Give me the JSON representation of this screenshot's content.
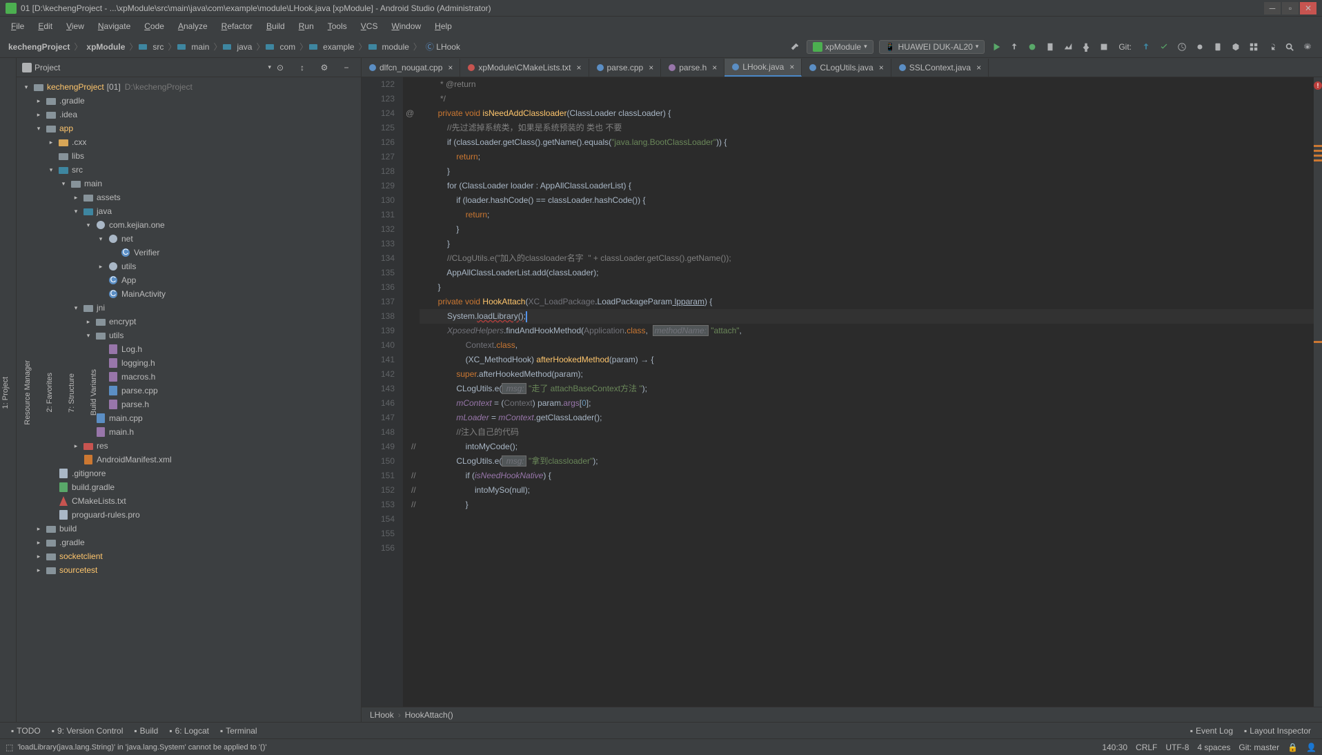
{
  "titlebar": "01 [D:\\kechengProject - ...\\xpModule\\src\\main\\java\\com\\example\\module\\LHook.java [xpModule] - Android Studio (Administrator)",
  "menu": [
    "File",
    "Edit",
    "View",
    "Navigate",
    "Code",
    "Analyze",
    "Refactor",
    "Build",
    "Run",
    "Tools",
    "VCS",
    "Window",
    "Help"
  ],
  "breadcrumb": [
    "kechengProject",
    "xpModule",
    "src",
    "main",
    "java",
    "com",
    "example",
    "module",
    "LHook"
  ],
  "runConfig": {
    "module": "xpModule",
    "device": "HUAWEI DUK-AL20"
  },
  "gitLabel": "Git:",
  "projectPanel": {
    "title": "Project"
  },
  "leftGutter": [
    "1: Project",
    "Resource Manager",
    "2: Favorites",
    "7: Structure",
    "Build Variants"
  ],
  "tree": {
    "root": {
      "name": "kechengProject",
      "tag": "[01]",
      "hint": "D:\\kechengProject"
    },
    "nodes": [
      {
        "indent": 1,
        "arrow": "▸",
        "icon": "folder",
        "label": ".gradle"
      },
      {
        "indent": 1,
        "arrow": "▸",
        "icon": "folder",
        "label": ".idea"
      },
      {
        "indent": 1,
        "arrow": "▾",
        "icon": "folder",
        "label": "app",
        "highlight": true
      },
      {
        "indent": 2,
        "arrow": "▸",
        "icon": "folder-y",
        "label": ".cxx"
      },
      {
        "indent": 2,
        "arrow": "",
        "icon": "folder",
        "label": "libs"
      },
      {
        "indent": 2,
        "arrow": "▾",
        "icon": "folder-src",
        "label": "src"
      },
      {
        "indent": 3,
        "arrow": "▾",
        "icon": "folder",
        "label": "main"
      },
      {
        "indent": 4,
        "arrow": "▸",
        "icon": "folder",
        "label": "assets"
      },
      {
        "indent": 4,
        "arrow": "▾",
        "icon": "folder-src",
        "label": "java"
      },
      {
        "indent": 5,
        "arrow": "▾",
        "icon": "pkg",
        "label": "com.kejian.one"
      },
      {
        "indent": 6,
        "arrow": "▾",
        "icon": "pkg",
        "label": "net"
      },
      {
        "indent": 7,
        "arrow": "",
        "icon": "class",
        "label": "Verifier"
      },
      {
        "indent": 6,
        "arrow": "▸",
        "icon": "pkg",
        "label": "utils"
      },
      {
        "indent": 6,
        "arrow": "",
        "icon": "class",
        "label": "App"
      },
      {
        "indent": 6,
        "arrow": "",
        "icon": "class",
        "label": "MainActivity"
      },
      {
        "indent": 4,
        "arrow": "▾",
        "icon": "folder",
        "label": "jni"
      },
      {
        "indent": 5,
        "arrow": "▸",
        "icon": "folder",
        "label": "encrypt"
      },
      {
        "indent": 5,
        "arrow": "▾",
        "icon": "folder",
        "label": "utils"
      },
      {
        "indent": 6,
        "arrow": "",
        "icon": "file-h",
        "label": "Log.h"
      },
      {
        "indent": 6,
        "arrow": "",
        "icon": "file-h",
        "label": "logging.h"
      },
      {
        "indent": 6,
        "arrow": "",
        "icon": "file-h",
        "label": "macros.h"
      },
      {
        "indent": 6,
        "arrow": "",
        "icon": "file-cpp",
        "label": "parse.cpp"
      },
      {
        "indent": 6,
        "arrow": "",
        "icon": "file-h",
        "label": "parse.h"
      },
      {
        "indent": 5,
        "arrow": "",
        "icon": "file-cpp",
        "label": "main.cpp"
      },
      {
        "indent": 5,
        "arrow": "",
        "icon": "file-h",
        "label": "main.h"
      },
      {
        "indent": 4,
        "arrow": "▸",
        "icon": "folder-res",
        "label": "res"
      },
      {
        "indent": 4,
        "arrow": "",
        "icon": "file-xml",
        "label": "AndroidManifest.xml"
      },
      {
        "indent": 2,
        "arrow": "",
        "icon": "file",
        "label": ".gitignore"
      },
      {
        "indent": 2,
        "arrow": "",
        "icon": "file-gradle",
        "label": "build.gradle"
      },
      {
        "indent": 2,
        "arrow": "",
        "icon": "file-cmake",
        "label": "CMakeLists.txt"
      },
      {
        "indent": 2,
        "arrow": "",
        "icon": "file",
        "label": "proguard-rules.pro"
      },
      {
        "indent": 1,
        "arrow": "▸",
        "icon": "folder",
        "label": "build"
      },
      {
        "indent": 1,
        "arrow": "▸",
        "icon": "folder",
        "label": ".gradle"
      },
      {
        "indent": 1,
        "arrow": "▸",
        "icon": "folder",
        "label": "socketclient",
        "highlight": true
      },
      {
        "indent": 1,
        "arrow": "▸",
        "icon": "folder",
        "label": "sourcetest",
        "highlight": true
      }
    ]
  },
  "tabs": [
    {
      "icon": "cpp",
      "label": "dlfcn_nougat.cpp"
    },
    {
      "icon": "cmake",
      "label": "xpModule\\CMakeLists.txt"
    },
    {
      "icon": "cpp",
      "label": "parse.cpp"
    },
    {
      "icon": "h",
      "label": "parse.h"
    },
    {
      "icon": "java",
      "label": "LHook.java",
      "active": true
    },
    {
      "icon": "java",
      "label": "CLogUtils.java"
    },
    {
      "icon": "java",
      "label": "SSLContext.java"
    }
  ],
  "code": {
    "lines": [
      122,
      123,
      124,
      125,
      126,
      127,
      128,
      129,
      130,
      131,
      132,
      133,
      134,
      135,
      136,
      137,
      138,
      139,
      140,
      141,
      142,
      143,
      146,
      147,
      148,
      149,
      150,
      151,
      152,
      153,
      154,
      155,
      156
    ],
    "content": {
      "l122": "         * @return",
      "l123": "         */",
      "l124_kw1": "private",
      "l124_kw2": "void",
      "l124_fn": "isNeedAddClassloader",
      "l124_rest": "(ClassLoader classLoader) {",
      "l126_cmt": "            //先过滤掉系统类，如果是系统预装的 类也 不要",
      "l127_a": "            if (classLoader.getClass().getName().equals(",
      "l127_s": "\"java.lang.BootClassLoader\"",
      "l127_b": ")) {",
      "l128_kw": "return",
      "l128_s": ";",
      "l129": "            }",
      "l130_a": "            for (",
      "l130_t": "ClassLoader",
      "l130_b": " loader : AppAllClassLoaderList) {",
      "l131": "                if (loader.hashCode() == classLoader.hashCode()) {",
      "l132_kw": "return",
      "l132_s": ";",
      "l133": "                }",
      "l134": "            }",
      "l135_cmt": "            //CLogUtils.e(\"加入的classloader名字  \" + classLoader.getClass().getName());",
      "l136": "            AppAllClassLoaderList.add(classLoader);",
      "l137": "        }",
      "l139_kw1": "private",
      "l139_kw2": "void",
      "l139_fn": "HookAttach",
      "l139_a": "(",
      "l139_t1": "XC_LoadPackage",
      "l139_t2": ".LoadPackageParam",
      "l139_p": " lpparam",
      "l139_b": ") {",
      "l140_a": "            System.",
      "l140_err": "loadLibrary()",
      "l140_b": ";",
      "l141_a": "            ",
      "l141_t": "XposedHelpers",
      "l141_b": ".findAndHookMethod(",
      "l141_c": "Application",
      "l141_d": ".",
      "l141_kw": "class",
      "l141_e": ",  ",
      "l141_hl": "methodName:",
      "l141_s": " \"attach\"",
      "l141_f": ",",
      "l142_a": "                    ",
      "l142_t": "Context",
      "l142_b": ".",
      "l142_kw": "class",
      "l142_c": ",",
      "l143_a": "                    (XC_MethodHook) ",
      "l143_fn": "afterHookedMethod",
      "l143_b": "(param) → {",
      "l146_a": "                ",
      "l146_kw": "super",
      "l146_b": ".afterHookedMethod(param);",
      "l147_a": "                CLogUtils.e(",
      "l147_hl": " msg:",
      "l147_s": " \"走了 attachBaseContext方法 \"",
      "l147_b": ");",
      "l148_a": "                ",
      "l148_f": "mContext",
      "l148_b": " = (",
      "l148_t": "Context",
      "l148_c": ") param.",
      "l148_f2": "args",
      "l148_d": "[",
      "l148_n": "0",
      "l148_e": "];",
      "l149_a": "                ",
      "l149_f": "mLoader",
      "l149_b": " = ",
      "l149_f2": "mContext",
      "l149_c": ".getClassLoader();",
      "l150_cmt": "                //注入自己的代码",
      "l151": "                    intoMyCode();",
      "l153_a": "                CLogUtils.e(",
      "l153_hl": " msg:",
      "l153_s": " \"拿到classloader\"",
      "l153_b": ");",
      "l154_a": "                    if (",
      "l154_f": "isNeedHookNative",
      "l154_b": ") {",
      "l155": "                        intoMySo(null);",
      "l156": "                    }"
    }
  },
  "breadcrumbBottom": [
    "LHook",
    "HookAttach()"
  ],
  "bottomTools": [
    {
      "icon": "todo",
      "label": "TODO"
    },
    {
      "icon": "vcs",
      "label": "9: Version Control"
    },
    {
      "icon": "build",
      "label": "Build"
    },
    {
      "icon": "logcat",
      "label": "6: Logcat"
    },
    {
      "icon": "terminal",
      "label": "Terminal"
    }
  ],
  "bottomRight": [
    {
      "icon": "event",
      "label": "Event Log"
    },
    {
      "icon": "layout",
      "label": "Layout Inspector"
    }
  ],
  "status": {
    "msg": "'loadLibrary(java.lang.String)' in 'java.lang.System' cannot be applied to '()'",
    "pos": "140:30",
    "eol": "CRLF",
    "enc": "UTF-8",
    "indent": "4 spaces",
    "git": "Git: master"
  }
}
